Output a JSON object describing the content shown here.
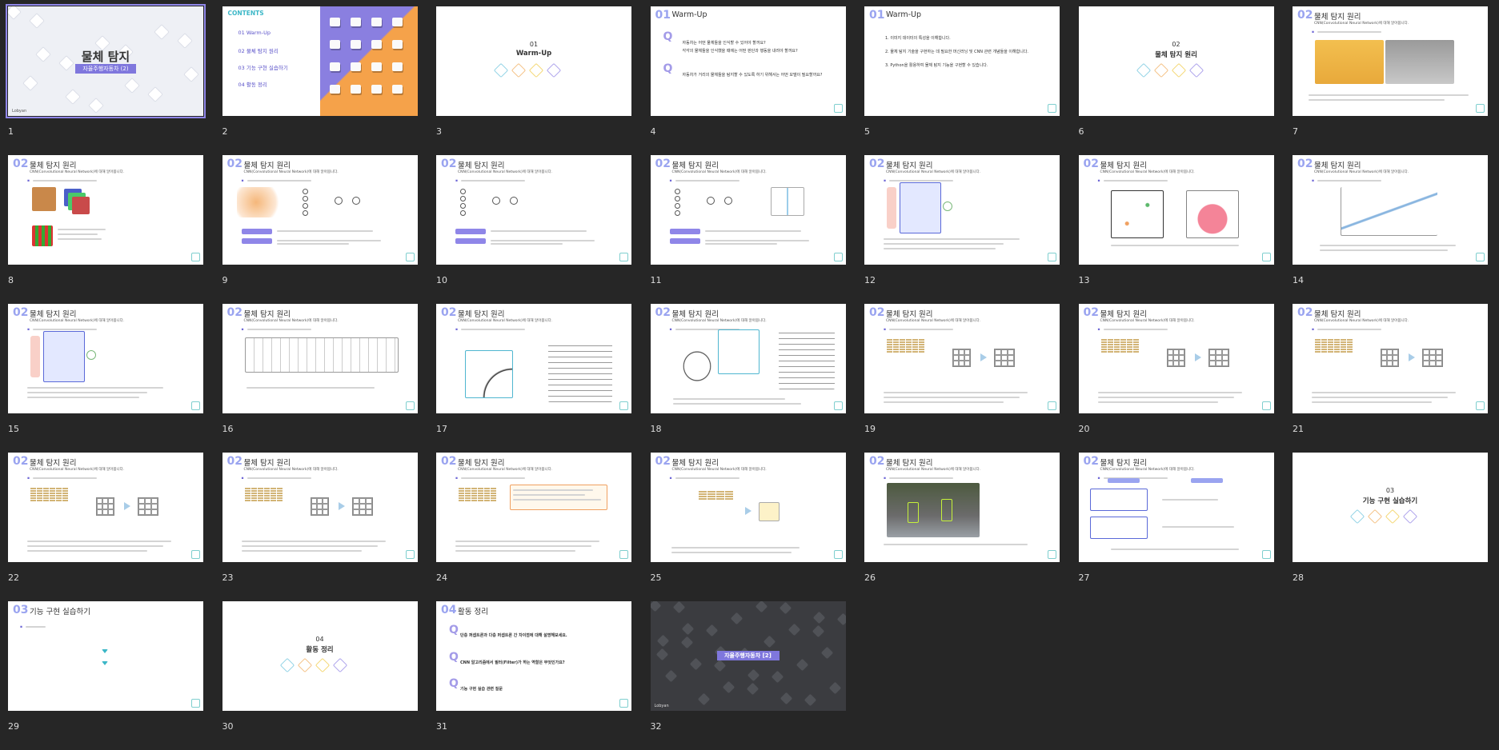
{
  "slides": [
    {
      "n": "1",
      "kind": "cover",
      "title": "물체 탐지",
      "subtitle": "자율주행자동차 (2)",
      "brand": "Lobyan"
    },
    {
      "n": "2",
      "kind": "contents",
      "heading": "CONTENTS",
      "items": [
        "01  Warm-Up",
        "02  물체 탐지 원리",
        "03  기능 구현 실습하기",
        "04  활동 정리"
      ]
    },
    {
      "n": "3",
      "kind": "section",
      "num": "01",
      "title": "Warm-Up"
    },
    {
      "n": "4",
      "kind": "warmup",
      "sec": "01",
      "title": "Warm-Up",
      "q1": "자동차는 어떤 물체들을 인식할 수 있어야 할까요?",
      "q1b": "각각의 물체들을 인식했을 때에는 어떤 판단과 행동을 내려야 할까요?",
      "q2": "자동차가 거리의 물체들을 탐지할 수 있도록 하기 위해서는 어떤 모델이 필요할까요?"
    },
    {
      "n": "5",
      "kind": "goals",
      "sec": "01",
      "title": "Warm-Up",
      "items": [
        "1. 이미지 데이터의 특성을 이해합니다.",
        "2. 물체 탐지 기술을 구현하는 데 필요한 머신러닝 및 CNN 관련 개념들을 이해합니다.",
        "3. Python을 활용하여 물체 탐지 기능을 구현할 수 있습니다."
      ]
    },
    {
      "n": "6",
      "kind": "section",
      "num": "02",
      "title": "물체 탐지 원리"
    },
    {
      "n": "7",
      "kind": "content",
      "sec": "02",
      "title": "물체 탐지 원리",
      "variant": "dogs"
    },
    {
      "n": "8",
      "kind": "content",
      "sec": "02",
      "title": "물체 탐지 원리",
      "variant": "rgb"
    },
    {
      "n": "9",
      "kind": "content",
      "sec": "02",
      "title": "물체 탐지 원리",
      "variant": "neuron"
    },
    {
      "n": "10",
      "kind": "content",
      "sec": "02",
      "title": "물체 탐지 원리",
      "variant": "perceptron"
    },
    {
      "n": "11",
      "kind": "content",
      "sec": "02",
      "title": "물체 탐지 원리",
      "variant": "activation"
    },
    {
      "n": "12",
      "kind": "content",
      "sec": "02",
      "title": "물체 탐지 원리",
      "variant": "mlp"
    },
    {
      "n": "13",
      "kind": "content",
      "sec": "02",
      "title": "물체 탐지 원리",
      "variant": "boundary"
    },
    {
      "n": "14",
      "kind": "content",
      "sec": "02",
      "title": "물체 탐지 원리",
      "variant": "sigmoid"
    },
    {
      "n": "15",
      "kind": "content",
      "sec": "02",
      "title": "물체 탐지 원리",
      "variant": "mlp"
    },
    {
      "n": "16",
      "kind": "content",
      "sec": "02",
      "title": "물체 탐지 원리",
      "variant": "cnn"
    },
    {
      "n": "17",
      "kind": "content",
      "sec": "02",
      "title": "물체 탐지 원리",
      "variant": "filter"
    },
    {
      "n": "18",
      "kind": "content",
      "sec": "02",
      "title": "물체 탐지 원리",
      "variant": "dolphin"
    },
    {
      "n": "19",
      "kind": "content",
      "sec": "02",
      "title": "물체 탐지 원리",
      "variant": "conv"
    },
    {
      "n": "20",
      "kind": "content",
      "sec": "02",
      "title": "물체 탐지 원리",
      "variant": "conv"
    },
    {
      "n": "21",
      "kind": "content",
      "sec": "02",
      "title": "물체 탐지 원리",
      "variant": "conv"
    },
    {
      "n": "22",
      "kind": "content",
      "sec": "02",
      "title": "물체 탐지 원리",
      "variant": "conv"
    },
    {
      "n": "23",
      "kind": "content",
      "sec": "02",
      "title": "물체 탐지 원리",
      "variant": "conv"
    },
    {
      "n": "24",
      "kind": "content",
      "sec": "02",
      "title": "물체 탐지 원리",
      "variant": "padding"
    },
    {
      "n": "25",
      "kind": "content",
      "sec": "02",
      "title": "물체 탐지 원리",
      "variant": "pooling"
    },
    {
      "n": "26",
      "kind": "content",
      "sec": "02",
      "title": "물체 탐지 원리",
      "variant": "street"
    },
    {
      "n": "27",
      "kind": "content",
      "sec": "02",
      "title": "물체 탐지 원리",
      "variant": "icons"
    },
    {
      "n": "28",
      "kind": "section",
      "num": "03",
      "title": "기능 구현 실습하기"
    },
    {
      "n": "29",
      "kind": "practice",
      "sec": "03",
      "title": "기능 구현 실습하기"
    },
    {
      "n": "30",
      "kind": "section",
      "num": "04",
      "title": "활동 정리"
    },
    {
      "n": "31",
      "kind": "summary",
      "sec": "04",
      "title": "활동 정리",
      "q1": "단층 퍼셉트론과 다층 퍼셉트론 간 차이점에 대해 설명해보세요.",
      "q2": "CNN 알고리즘에서 필터(Filter)가 하는 역할은 무엇인가요?",
      "q3": "기능 구현 실습 관련 질문"
    },
    {
      "n": "32",
      "kind": "dark",
      "title": "자율주행자동차 [2]",
      "brand": "Lobyan"
    }
  ],
  "sub_text": "CNN(Convolutional Neural Network)에 대해 알아봅니다.",
  "colors": {
    "accent": "#9aa4f0",
    "highlight": "#7f77dd",
    "teal": "#7fcfcf"
  }
}
